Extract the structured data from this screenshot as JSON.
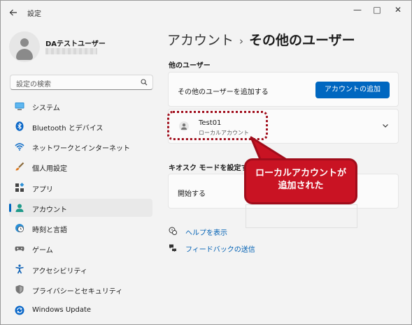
{
  "window": {
    "app_title": "設定",
    "back_icon": "back-arrow-icon",
    "min_glyph": "—",
    "max_glyph": "□",
    "close_glyph": "✕"
  },
  "user": {
    "display_name": "DAテストユーザー"
  },
  "search": {
    "placeholder": "設定の検索"
  },
  "sidebar": {
    "items": [
      {
        "label": "システム",
        "icon": "monitor-icon"
      },
      {
        "label": "Bluetooth とデバイス",
        "icon": "bluetooth-icon"
      },
      {
        "label": "ネットワークとインターネット",
        "icon": "wifi-icon"
      },
      {
        "label": "個人用設定",
        "icon": "brush-icon"
      },
      {
        "label": "アプリ",
        "icon": "apps-icon"
      },
      {
        "label": "アカウント",
        "icon": "person-icon",
        "selected": true
      },
      {
        "label": "時刻と言語",
        "icon": "clock-globe-icon"
      },
      {
        "label": "ゲーム",
        "icon": "gamepad-icon"
      },
      {
        "label": "アクセシビリティ",
        "icon": "accessibility-icon"
      },
      {
        "label": "プライバシーとセキュリティ",
        "icon": "shield-icon"
      },
      {
        "label": "Windows Update",
        "icon": "windows-update-icon"
      }
    ]
  },
  "main": {
    "breadcrumb_parent": "アカウント",
    "breadcrumb_separator": "›",
    "breadcrumb_current": "その他のユーザー",
    "other_users_title": "他のユーザー",
    "add_user_label": "その他のユーザーを追加する",
    "add_account_button": "アカウントの追加",
    "account": {
      "name": "Test01",
      "type": "ローカルアカウント"
    },
    "kiosk_title": "キオスク モードを設定する",
    "kiosk_start_label": "開始する",
    "help_link": "ヘルプを表示",
    "feedback_link": "フィードバックの送信"
  },
  "annotation": {
    "callout_line1": "ローカルアカウントが",
    "callout_line2": "追加された",
    "color": "#c91323"
  },
  "colors": {
    "accent": "#0067c0",
    "annotation": "#a00d1b"
  }
}
